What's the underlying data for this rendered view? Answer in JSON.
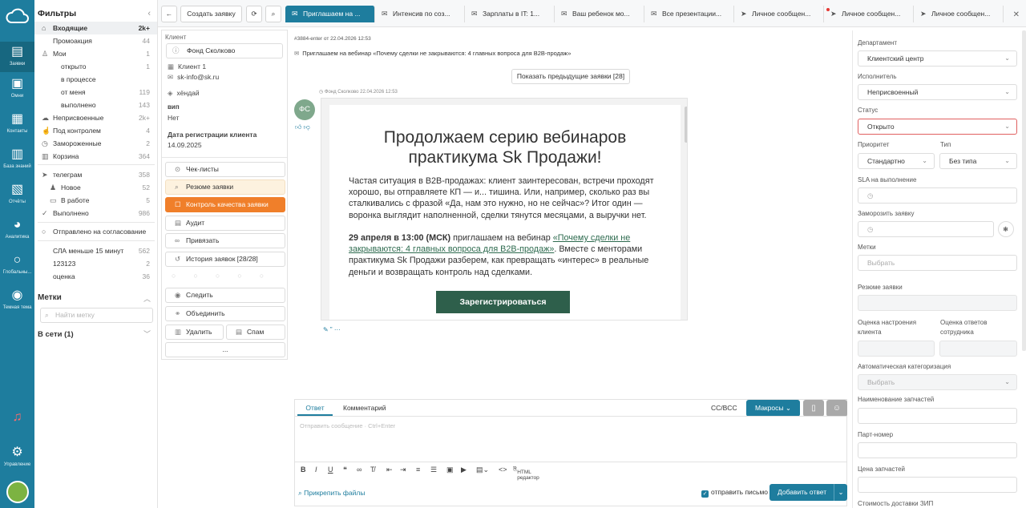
{
  "nav": {
    "items": [
      {
        "label": "Заявки",
        "icon": "tickets-icon"
      },
      {
        "label": "Омни",
        "icon": "omni-icon"
      },
      {
        "label": "Контакты",
        "icon": "contacts-icon"
      },
      {
        "label": "База знаний",
        "icon": "knowledge-icon"
      },
      {
        "label": "Отчёты",
        "icon": "reports-icon"
      },
      {
        "label": "Аналитика",
        "icon": "analytics-icon"
      },
      {
        "label": "Глобальны...",
        "icon": "search-icon"
      },
      {
        "label": "Темная тема",
        "icon": "toggle-icon"
      },
      {
        "label": "Управление",
        "icon": "settings-icon"
      }
    ]
  },
  "filters": {
    "title": "Фильтры",
    "rows": [
      {
        "label": "Входящие",
        "count": "2k+"
      },
      {
        "label": "Промоакция",
        "count": "44"
      },
      {
        "label": "Мои",
        "count": "1"
      },
      {
        "label": "открыто",
        "count": "1"
      },
      {
        "label": "в процессе",
        "count": ""
      },
      {
        "label": "от меня",
        "count": "119"
      },
      {
        "label": "выполнено",
        "count": "143"
      },
      {
        "label": "Неприсвоенные",
        "count": "2k+"
      },
      {
        "label": "Под контролем",
        "count": "4"
      },
      {
        "label": "Замороженные",
        "count": "2"
      },
      {
        "label": "Корзина",
        "count": "364"
      },
      {
        "label": "телеграм",
        "count": "358"
      },
      {
        "label": "Новое",
        "count": "52"
      },
      {
        "label": "В работе",
        "count": "5"
      },
      {
        "label": "Выполнено",
        "count": "986"
      },
      {
        "label": "Отправлено на согласование",
        "count": ""
      },
      {
        "label": "СЛА меньше 15 минут",
        "count": "562"
      },
      {
        "label": "123123",
        "count": "2"
      },
      {
        "label": "оценка",
        "count": "36"
      }
    ],
    "tags_title": "Метки",
    "tags_placeholder": "Найти метку",
    "online": "В сети (1)"
  },
  "topbar": {
    "create": "Создать заявку",
    "tabs": [
      "Приглашаем на ...",
      "Интенсив по соз...",
      "Зарплаты в IT: 1...",
      "Ваш ребенок мо...",
      "Все презентации...",
      "Личное сообщен...",
      "Личное сообщен...",
      "Личное сообщен..."
    ]
  },
  "client": {
    "label": "Клиент",
    "name": "Фонд Сколково",
    "client_no": "Клиент 1",
    "email": "sk-info@sk.ru",
    "tag": "хёндай",
    "vip_label": "вип",
    "vip_value": "Нет",
    "reg_label": "Дата регистрации клиента",
    "reg_value": "14.09.2025"
  },
  "actions": {
    "checklists": "Чек-листы",
    "summary": "Резюме заявки",
    "quality": "Контроль качества заявки",
    "audit": "Аудит",
    "link": "Привязать",
    "history": "История заявок [28/28]",
    "follow": "Следить",
    "merge": "Объединить",
    "delete": "Удалить",
    "spam": "Спам",
    "more": "..."
  },
  "conversation": {
    "header": "#3884-enter от 22.04.2026 12:53",
    "subject": "Приглашаем на вебинар «Почему сделки не закрываются: 4 главных вопроса для B2B-продаж»",
    "show_prev": "Показать предыдущие заявки [28]",
    "sender": "Фонд Сколково 22.04.2026 12:53",
    "avatar": "ФС",
    "email": {
      "title_line1": "Продолжаем серию вебинаров",
      "title_line2": "практикума Sk Продажи!",
      "para1": "Частая ситуация в B2B-продажах: клиент заинтересован, встречи проходят хорошо, вы отправляете КП — и... тишина. Или, например, сколько раз вы сталкивались с фразой «Да, нам это нужно, но не сейчас»? Итог один — воронка выглядит наполненной, сделки тянутся месяцами, а выручки нет.",
      "para2_bold": "29 апреля в 13:00 (МСК)",
      "para2_text": " приглашаем на вебинар ",
      "para2_link": "«Почему сделки не закрываются: 4 главных вопроса для B2B-продаж»",
      "para2_tail": ". Вместе с менторами практикума Sk Продажи разберем, как превращать «интерес» в реальные деньги и возвращать контроль над сделками.",
      "button": "Зарегистрироваться"
    }
  },
  "reply": {
    "tab_reply": "Ответ",
    "tab_comment": "Комментарий",
    "cc": "CC/BCC",
    "macros": "Макросы",
    "placeholder": "Отправить сообщение · Ctrl+Enter",
    "html_editor": "HTML редактор",
    "attach": "Прикрепить файлы",
    "send_email": "отправить письмо",
    "send": "Добавить ответ"
  },
  "props": {
    "dept_label": "Департамент",
    "dept": "Клиентский центр",
    "assignee_label": "Исполнитель",
    "assignee": "Неприсвоенный",
    "status_label": "Статус",
    "status": "Открыто",
    "priority_label": "Приоритет",
    "priority": "Стандартно",
    "type_label": "Тип",
    "type": "Без типа",
    "sla_label": "SLA на выполнение",
    "freeze_label": "Заморозить заявку",
    "tags_label": "Метки",
    "tags_placeholder": "Выбрать",
    "summary_label": "Резюме заявки",
    "mood_label": "Оценка настроения клиента",
    "staff_label": "Оценка ответов сотрудника",
    "autocat_label": "Автоматическая категоризация",
    "autocat_placeholder": "Выбрать",
    "parts_label": "Наименование запчастей",
    "partno_label": "Парт-номер",
    "price_label": "Цена запчастей",
    "delivery_label": "Стоимость доставки ЗИП"
  },
  "colors": {
    "brand": "#1e7d9e",
    "quality": "#f07f2a",
    "email_button": "#2e5f4b"
  }
}
